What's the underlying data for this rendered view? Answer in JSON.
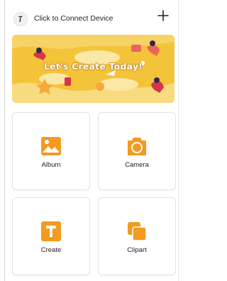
{
  "header": {
    "connect_label": "Click to Connect Device",
    "add_icon": "plus-icon",
    "logo_icon": "device-logo-icon"
  },
  "banner": {
    "text": "Let's Create Today!",
    "background_color": "#f3c33a"
  },
  "tiles": [
    {
      "label": "Album",
      "icon": "image-icon"
    },
    {
      "label": "Camera",
      "icon": "camera-icon"
    },
    {
      "label": "Create",
      "icon": "text-t-icon"
    },
    {
      "label": "Clipart",
      "icon": "copy-icon"
    }
  ],
  "colors": {
    "accent": "#f39a1f",
    "tile_border": "#e3e3e3"
  }
}
